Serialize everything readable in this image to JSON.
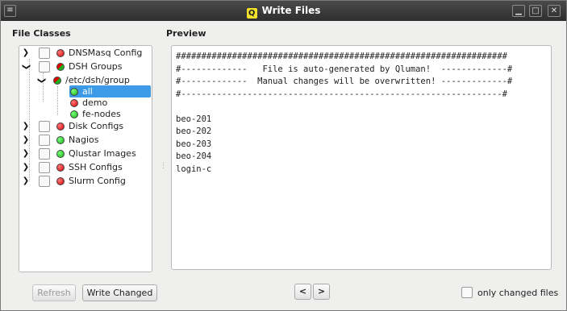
{
  "window": {
    "title": "Write Files",
    "app_logo": "Q"
  },
  "file_classes": {
    "heading": "File Classes",
    "items": [
      {
        "label": "DNSMasq Config",
        "status": "red"
      },
      {
        "label": "DSH Groups",
        "status": "mixed"
      },
      {
        "label": "/etc/dsh/group",
        "status": "mixed"
      },
      {
        "label": "all",
        "status": "green",
        "selected": true
      },
      {
        "label": "demo",
        "status": "red"
      },
      {
        "label": "fe-nodes",
        "status": "green"
      },
      {
        "label": "Disk Configs",
        "status": "red"
      },
      {
        "label": "Nagios",
        "status": "green"
      },
      {
        "label": "Qlustar Images",
        "status": "green"
      },
      {
        "label": "SSH Configs",
        "status": "red"
      },
      {
        "label": "Slurm Config",
        "status": "red"
      }
    ]
  },
  "preview": {
    "heading": "Preview",
    "content": "#################################################################\n#-------------   File is auto-generated by Qluman!  -------------#\n#-------------  Manual changes will be overwritten! -------------#\n#---------------------------------------------------------------#\n\nbeo-201\nbeo-202\nbeo-203\nbeo-204\nlogin-c"
  },
  "footer": {
    "refresh_label": "Refresh",
    "write_changed_label": "Write Changed",
    "prev_label": "<",
    "next_label": ">",
    "only_changed_label": "only changed files"
  },
  "colors": {
    "titlebar": "#333333",
    "selection": "#3d9ae6",
    "status_red": "#d40000",
    "status_green": "#12b012"
  }
}
